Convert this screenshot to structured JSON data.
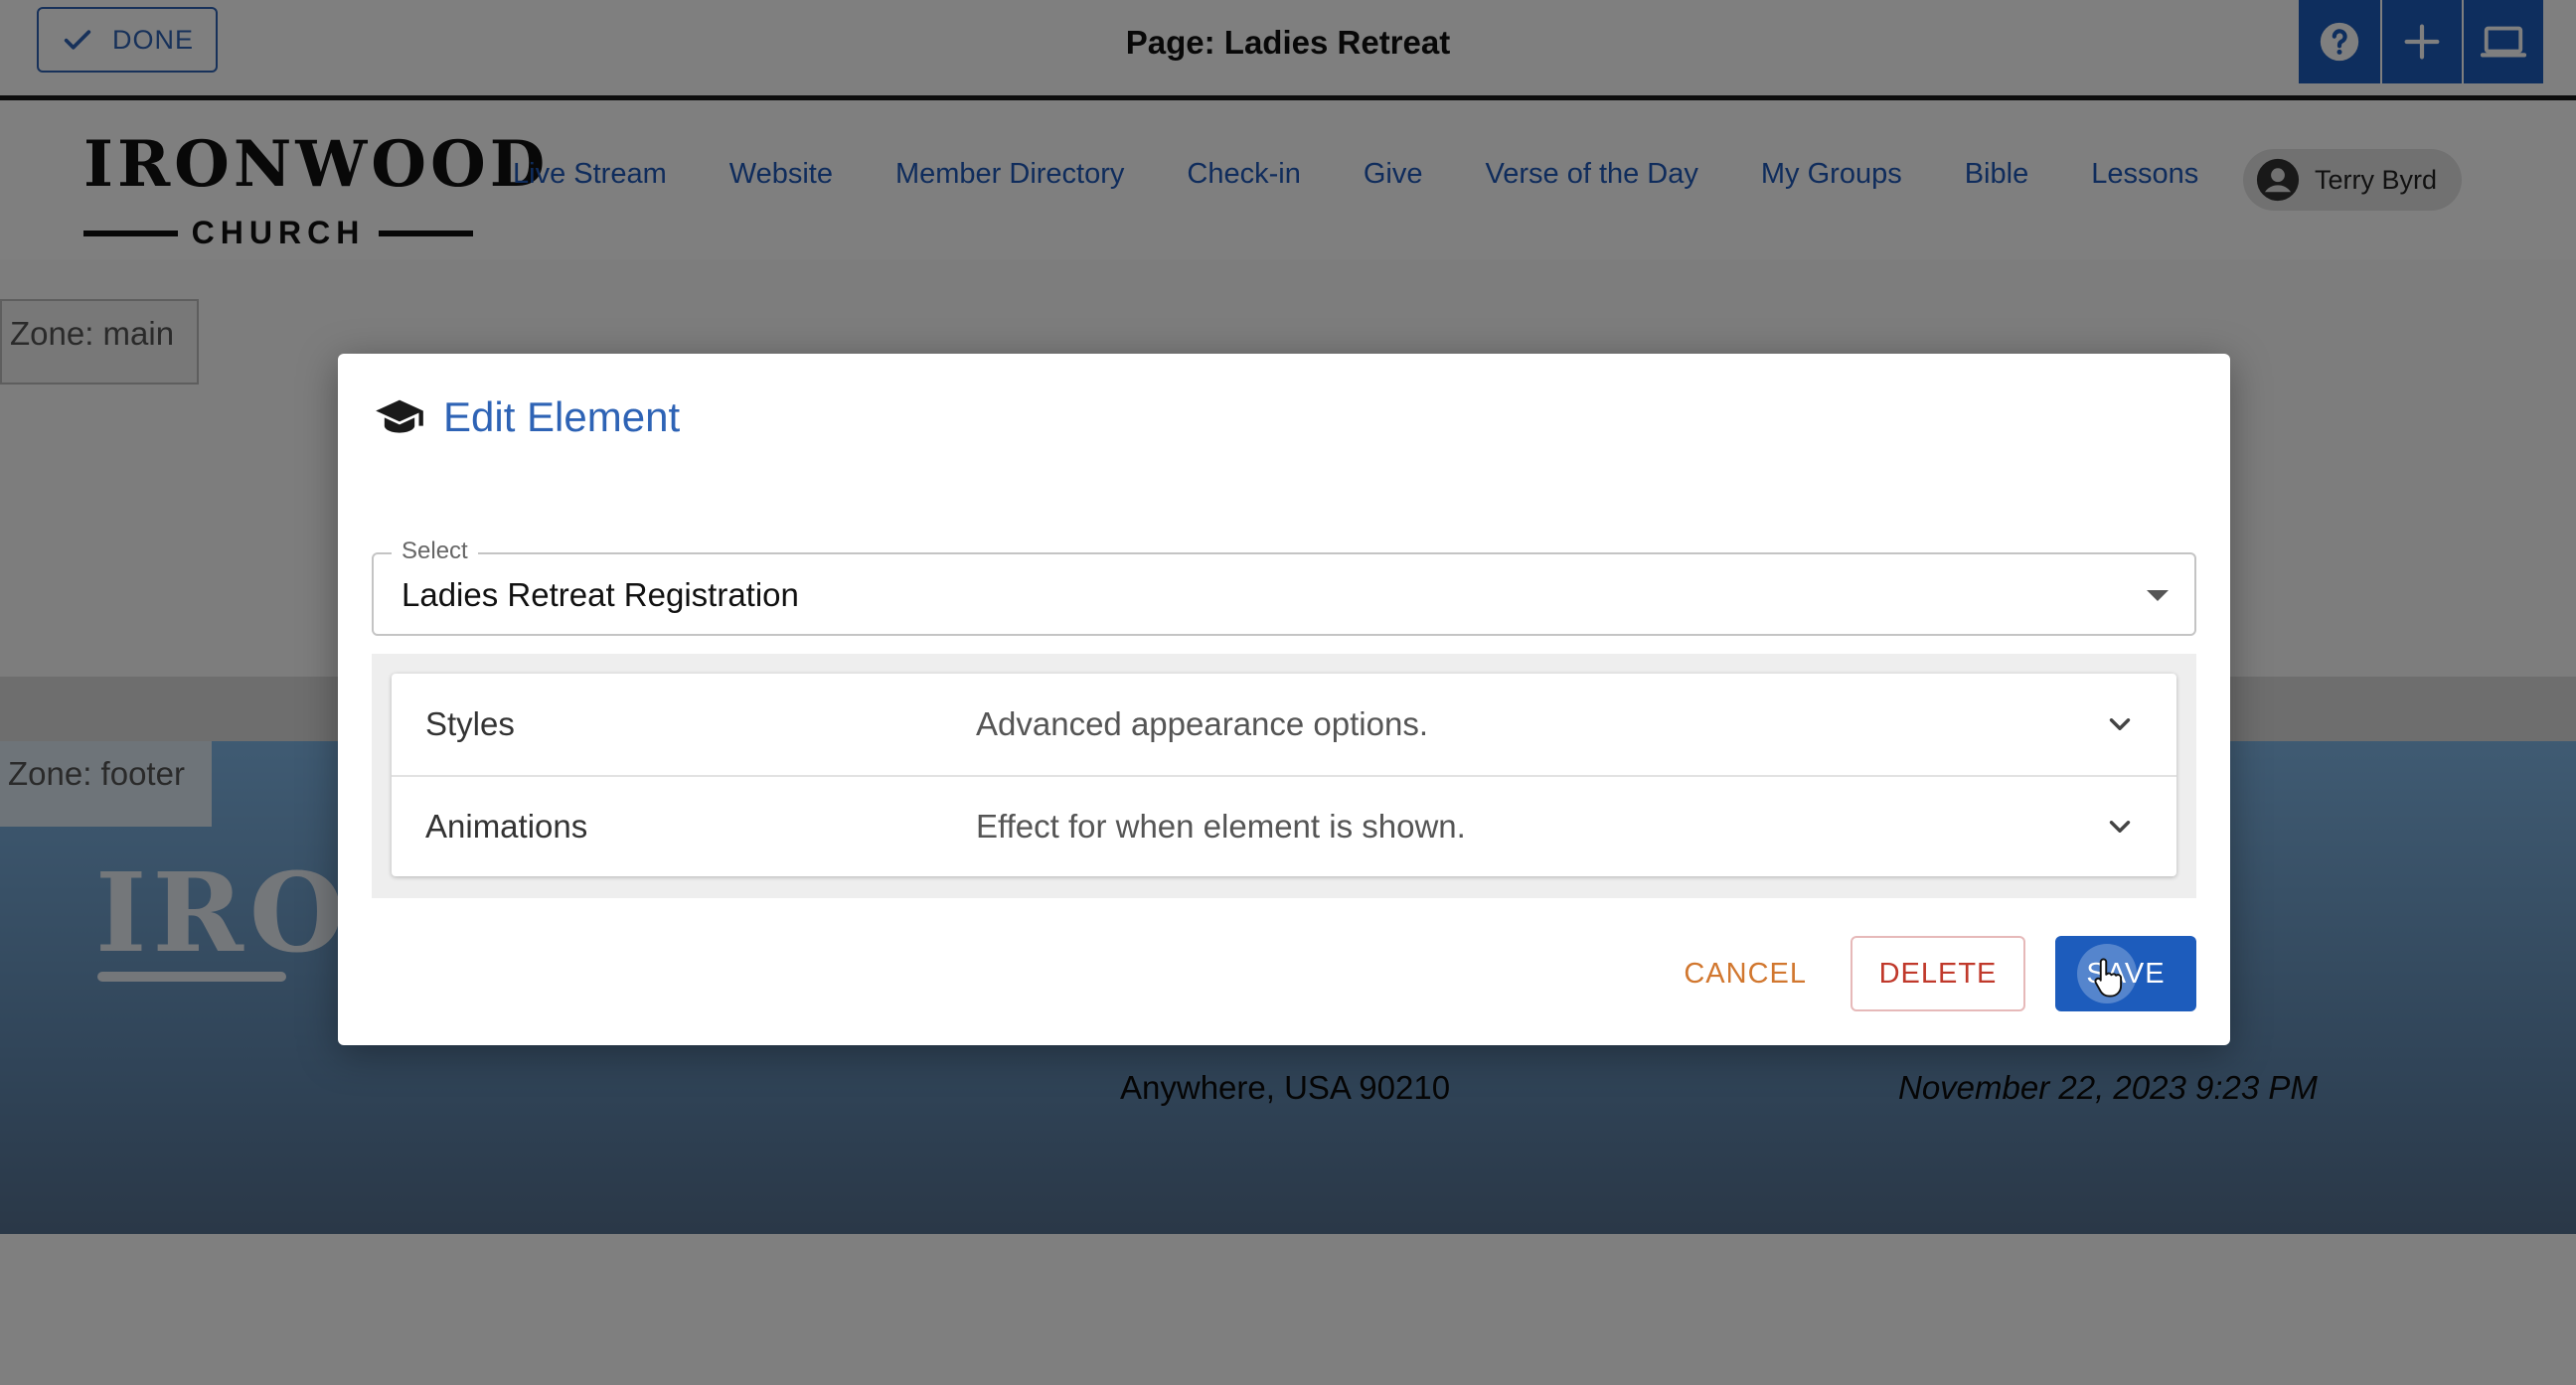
{
  "topbar": {
    "done_label": "DONE",
    "page_title": "Page: Ladies Retreat",
    "tools": [
      {
        "icon": "help-icon"
      },
      {
        "icon": "plus-icon"
      },
      {
        "icon": "monitor-icon"
      }
    ]
  },
  "nav": {
    "logo_word": "IRONWOOD",
    "logo_sub": "CHURCH",
    "links": [
      "Live Stream",
      "Website",
      "Member Directory",
      "Check-in",
      "Give",
      "Verse of the Day",
      "My Groups",
      "Bible",
      "Lessons"
    ],
    "user_name": "Terry Byrd"
  },
  "zones": {
    "main_label": "Zone: main",
    "footer_label": "Zone: footer"
  },
  "footer": {
    "logo_partial": "IRO",
    "address": "Anywhere, USA 90210",
    "datetime": "November 22, 2023 9:23 PM"
  },
  "dialog": {
    "title": "Edit Element",
    "select_label": "Select",
    "select_value": "Ladies Retreat Registration",
    "sections": [
      {
        "title": "Styles",
        "description": "Advanced appearance options."
      },
      {
        "title": "Animations",
        "description": "Effect for when element is shown."
      }
    ],
    "cancel_label": "CANCEL",
    "delete_label": "DELETE",
    "save_label": "SAVE"
  },
  "colors": {
    "primary": "#1d5cbc",
    "link": "#1f58b8",
    "cancel": "#d1772f",
    "delete": "#c0392b",
    "title": "#2e63b5"
  }
}
